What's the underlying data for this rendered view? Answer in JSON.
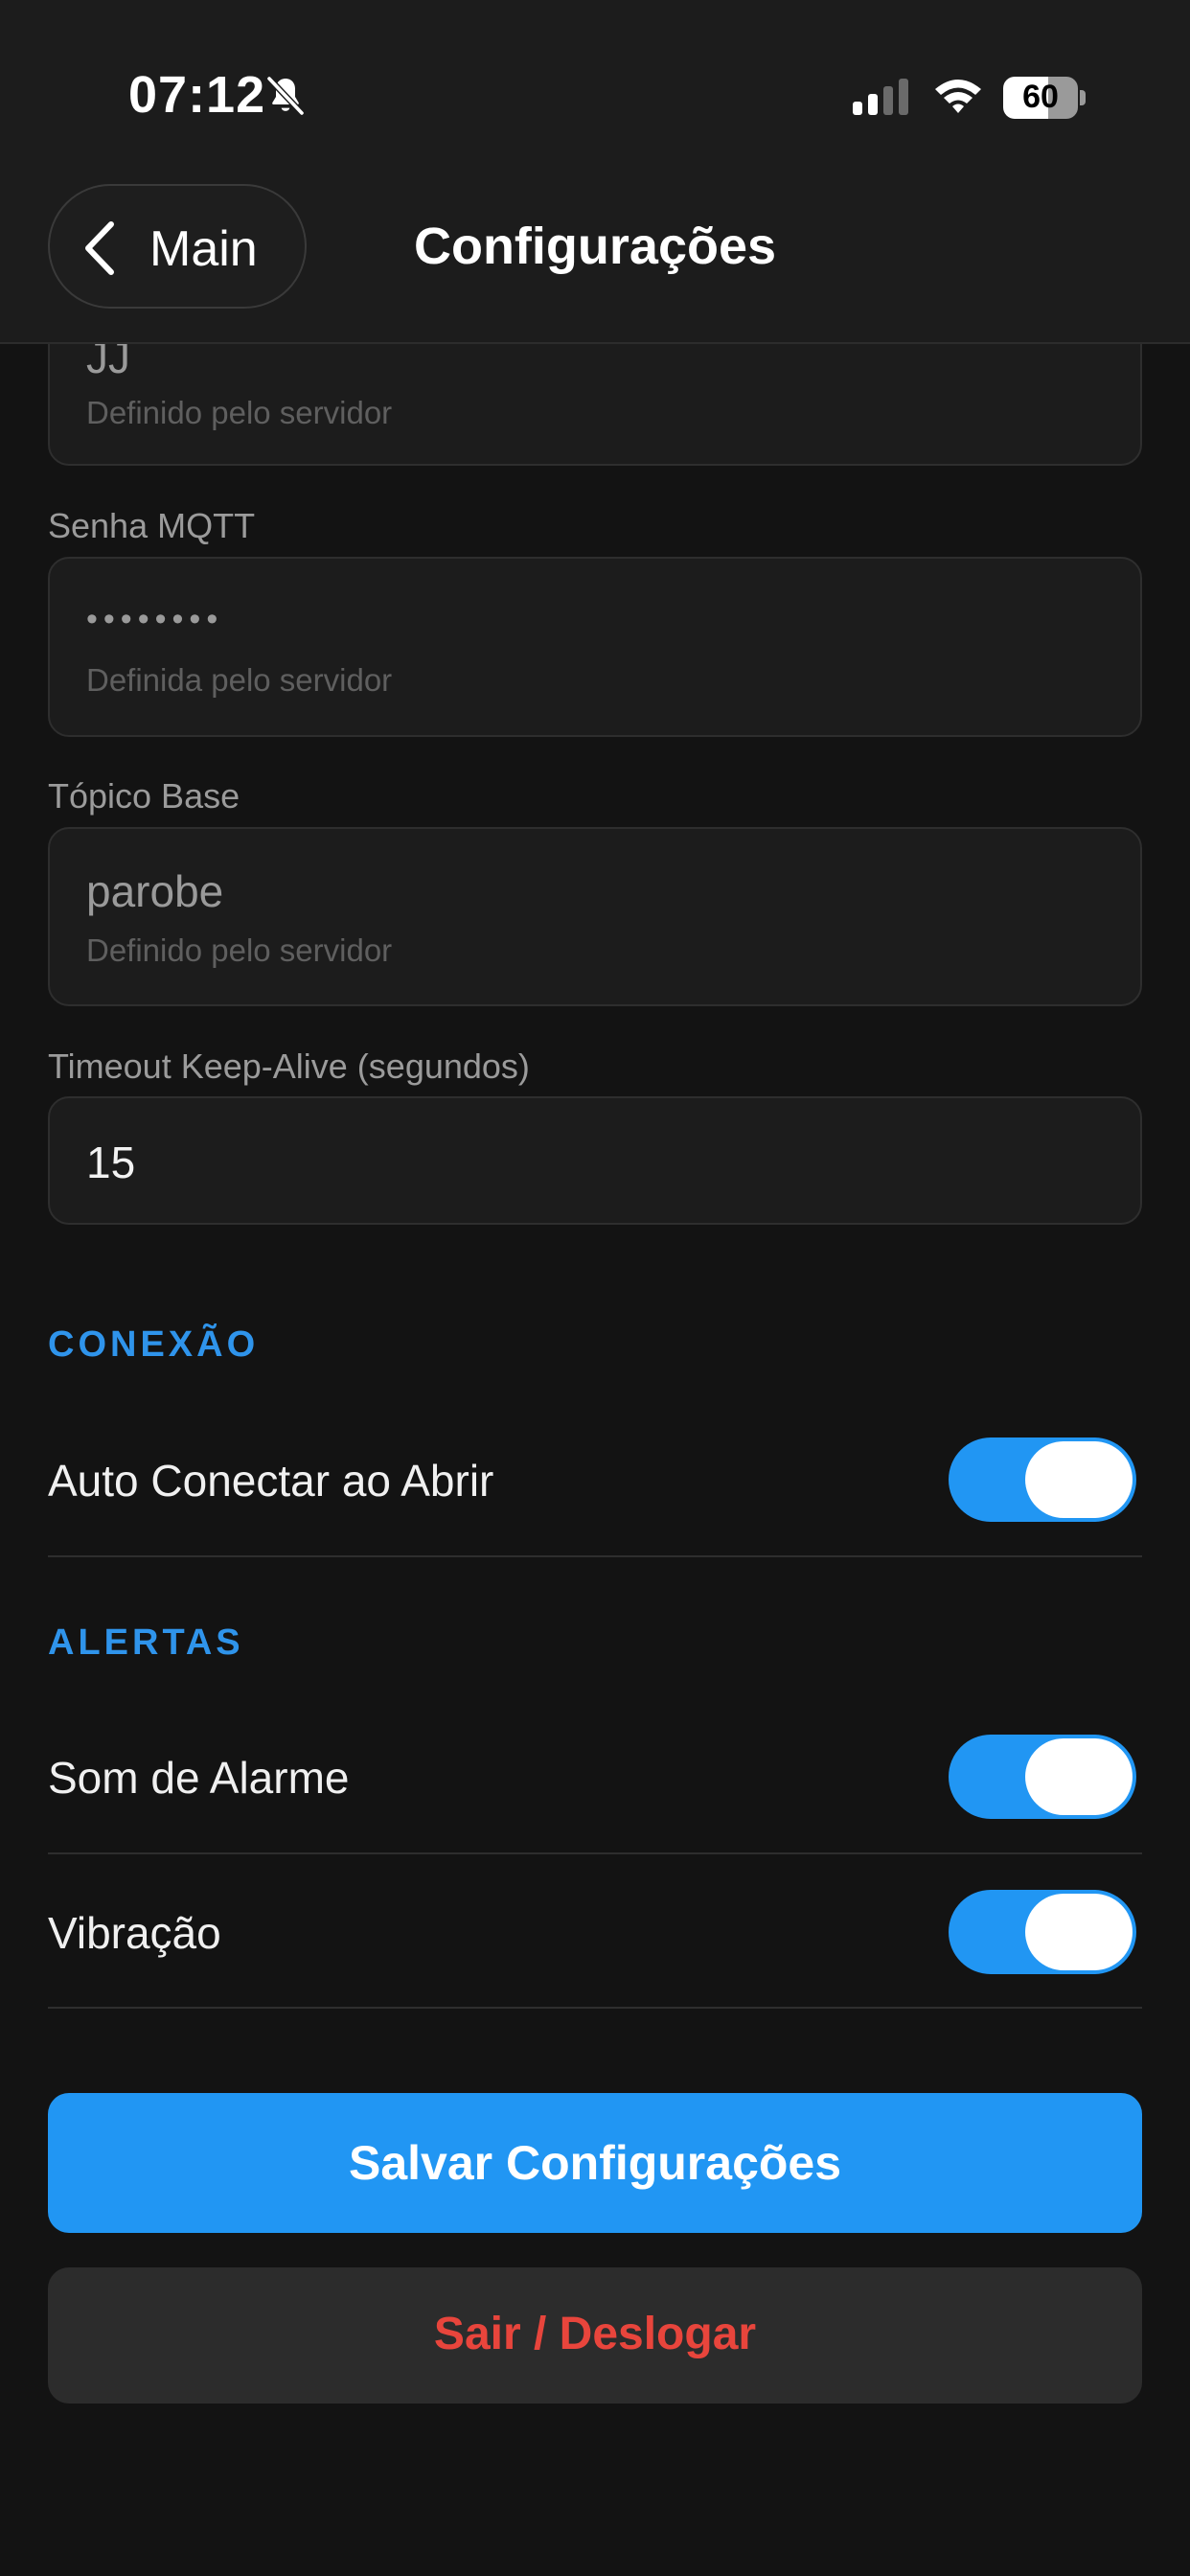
{
  "status_bar": {
    "time": "07:12",
    "battery_level": "60",
    "battery_fraction": 0.6
  },
  "nav": {
    "back_label": "Main",
    "title": "Configurações"
  },
  "form": {
    "user_field": {
      "value": "JJ",
      "hint": "Definido pelo servidor"
    },
    "password_field": {
      "label": "Senha MQTT",
      "value": "••••••••",
      "hint": "Definida pelo servidor"
    },
    "topic_field": {
      "label": "Tópico Base",
      "value": "parobe",
      "hint": "Definido pelo servidor"
    },
    "keepalive_field": {
      "label": "Timeout Keep-Alive (segundos)",
      "value": "15"
    }
  },
  "sections": {
    "connection": {
      "title": "CONEXÃO",
      "items": [
        {
          "label": "Auto Conectar ao Abrir",
          "enabled": true
        }
      ]
    },
    "alerts": {
      "title": "ALERTAS",
      "items": [
        {
          "label": "Som de Alarme",
          "enabled": true
        },
        {
          "label": "Vibração",
          "enabled": true
        }
      ]
    }
  },
  "actions": {
    "save_label": "Salvar Configurações",
    "logout_label": "Sair / Deslogar"
  },
  "colors": {
    "accent": "#2196f3",
    "danger": "#e8453c",
    "background": "#131313"
  },
  "icons": [
    "bell-slash-icon",
    "signal-icon",
    "wifi-icon",
    "battery-icon",
    "chevron-left-icon"
  ]
}
